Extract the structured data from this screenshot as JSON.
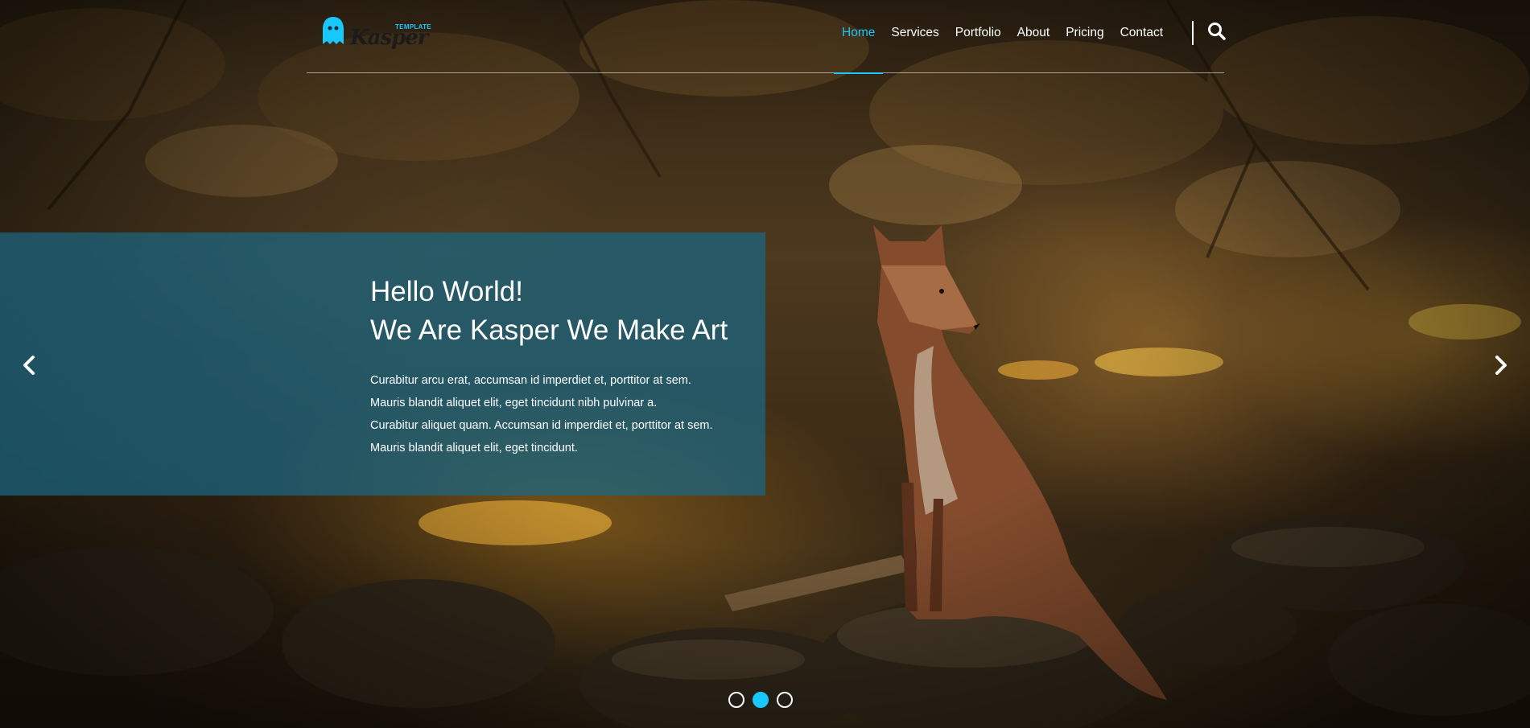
{
  "brand": {
    "logo_word": "Kasper",
    "logo_tag": "TEMPLATE",
    "accent": "#19c8fa"
  },
  "nav": {
    "items": [
      {
        "label": "Home",
        "active": true
      },
      {
        "label": "Services",
        "active": false
      },
      {
        "label": "Portfolio",
        "active": false
      },
      {
        "label": "About",
        "active": false
      },
      {
        "label": "Pricing",
        "active": false
      },
      {
        "label": "Contact",
        "active": false
      }
    ],
    "search_icon": "search-icon"
  },
  "slide": {
    "title_line1": "Hello World!",
    "title_line2": "We Are Kasper We Make Art",
    "lines": [
      "Curabitur arcu erat, accumsan id imperdiet et, porttitor at sem.",
      "Mauris blandit aliquet elit, eget tincidunt nibh pulvinar a.",
      "Curabitur aliquet quam. Accumsan id imperdiet et, porttitor at sem.",
      "Mauris blandit aliquet elit, eget tincidunt."
    ],
    "panel_color": "#1a6782"
  },
  "carousel": {
    "prev_icon": "chevron-left-icon",
    "next_icon": "chevron-right-icon",
    "dots": [
      {
        "active": false
      },
      {
        "active": true
      },
      {
        "active": false
      }
    ]
  }
}
